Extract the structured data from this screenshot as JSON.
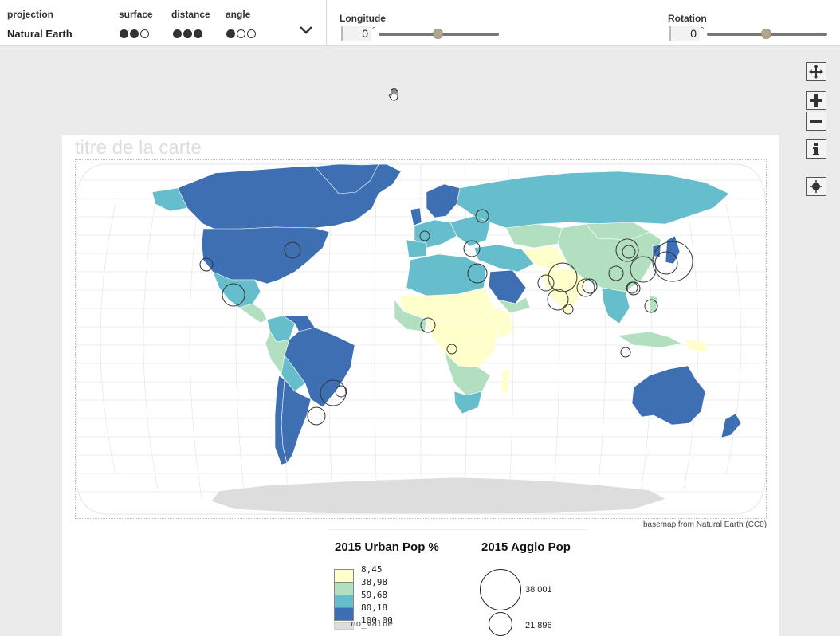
{
  "projection_panel": {
    "projection_label": "projection",
    "projection_value": "Natural Earth",
    "surface_label": "surface",
    "distance_label": "distance",
    "angle_label": "angle",
    "surface_rating": 2,
    "distance_rating": 3,
    "angle_rating": 1,
    "chevron_icon": "chevron-down-icon"
  },
  "controls": {
    "longitude_label": "Longitude",
    "longitude_value": "0",
    "longitude_unit": "°",
    "rotation_label": "Rotation",
    "rotation_value": "0",
    "rotation_unit": "°"
  },
  "tools": [
    "move-icon",
    "zoom-in-icon",
    "zoom-out-icon",
    "info-icon",
    "locate-icon"
  ],
  "map": {
    "title": "titre de la carte",
    "credit": "basemap from Natural Earth (CC0)",
    "colors": {
      "c1": "#ffffcc",
      "c2": "#b2dfc0",
      "c3": "#66bdcb",
      "c4": "#3d6fb2",
      "nodata": "#dddddd"
    }
  },
  "legend": {
    "choropleth_title": "2015 Urban Pop %",
    "breaks": [
      "8,45",
      "38,98",
      "59,68",
      "80,18",
      "100,00"
    ],
    "no_value_label": "no_value",
    "symbol_title": "2015 Agglo Pop",
    "symbol_values": [
      "38 001",
      "21 896"
    ]
  }
}
